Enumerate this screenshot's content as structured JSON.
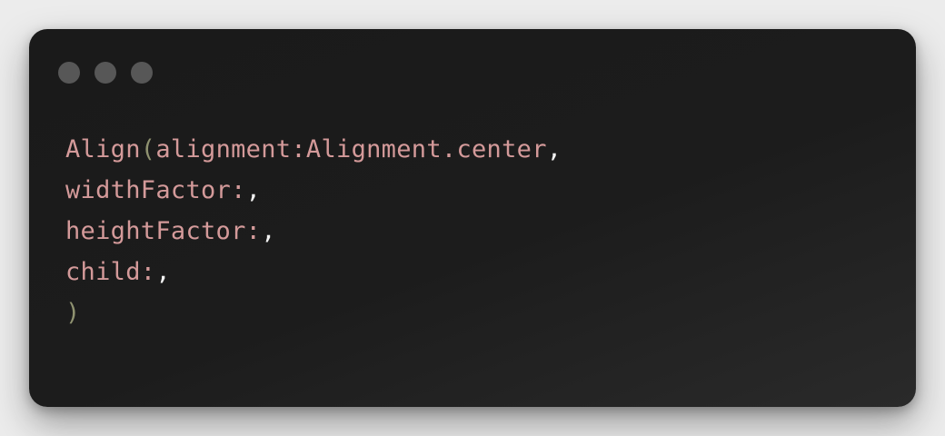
{
  "window": {
    "controls": [
      "window-dot",
      "window-dot",
      "window-dot"
    ]
  },
  "code": {
    "lines": [
      [
        {
          "text": "Align",
          "kind": "name"
        },
        {
          "text": "(",
          "kind": "paren"
        },
        {
          "text": "alignment:Alignment.center",
          "kind": "name"
        },
        {
          "text": ",",
          "kind": "punct"
        }
      ],
      [
        {
          "text": "widthFactor:",
          "kind": "name"
        },
        {
          "text": ",",
          "kind": "punct"
        }
      ],
      [
        {
          "text": "heightFactor:",
          "kind": "name"
        },
        {
          "text": ",",
          "kind": "punct"
        }
      ],
      [
        {
          "text": "child:",
          "kind": "name"
        },
        {
          "text": ",",
          "kind": "punct"
        }
      ],
      [
        {
          "text": ")",
          "kind": "paren"
        }
      ]
    ]
  },
  "colors": {
    "background": "#ececec",
    "window": "#1c1c1c",
    "dot": "#575757",
    "name": "#d49a9a",
    "paren": "#8f9270",
    "punct": "#f2f2f2"
  }
}
